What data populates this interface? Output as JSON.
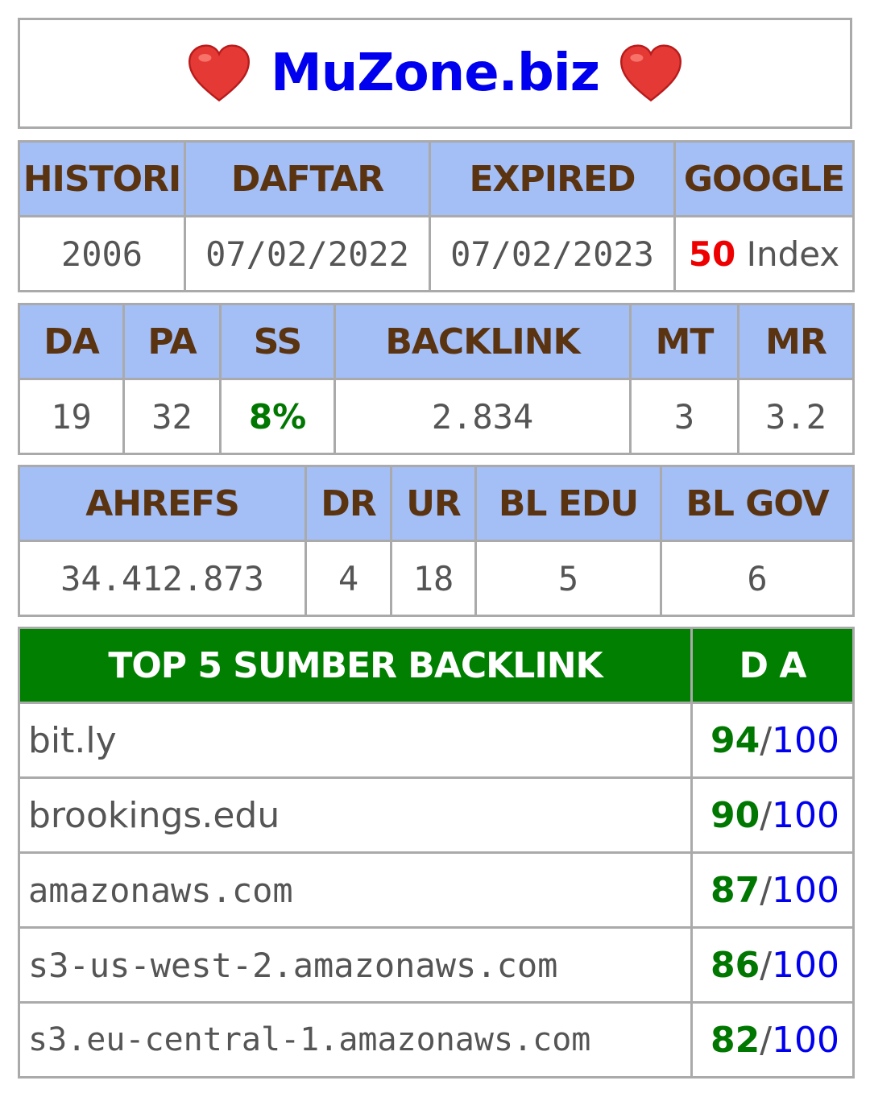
{
  "title": {
    "text": "MuZone.biz",
    "left_icon": "heart-icon",
    "right_icon": "heart-icon",
    "heart_color": "#e53935"
  },
  "domain_info": {
    "headers": [
      "HISTORI",
      "DAFTAR",
      "EXPIRED",
      "GOOGLE"
    ],
    "values": {
      "histori": "2006",
      "daftar": "07/02/2022",
      "expired": "07/02/2023",
      "google_count": "50",
      "google_suffix": " Index"
    }
  },
  "moz_metrics": {
    "headers": [
      "DA",
      "PA",
      "SS",
      "BACKLINK",
      "MT",
      "MR"
    ],
    "values": [
      "19",
      "32",
      "8%",
      "2.834",
      "3",
      "3.2"
    ]
  },
  "ahrefs_metrics": {
    "headers": [
      "AHREFS",
      "DR",
      "UR",
      "BL EDU",
      "BL GOV"
    ],
    "values": [
      "34.412.873",
      "4",
      "18",
      "5",
      "6"
    ]
  },
  "top_backlinks": {
    "header_source": "TOP 5 SUMBER BACKLINK",
    "header_da": "D A",
    "separator": "/",
    "max": "100",
    "rows": [
      {
        "site": "bit.ly",
        "da": "94"
      },
      {
        "site": "brookings.edu",
        "da": "90"
      },
      {
        "site": "amazonaws.com",
        "da": "87"
      },
      {
        "site": "s3-us-west-2.amazonaws.com",
        "da": "86"
      },
      {
        "site": "s3.eu-central-1.amazonaws.com",
        "da": "82"
      }
    ]
  },
  "colors": {
    "header_bg": "#a4bef6",
    "header_text": "#5a3310",
    "top_header_bg": "#007f00",
    "green": "#007700",
    "blue": "#0000ee",
    "red": "#ee0000"
  }
}
